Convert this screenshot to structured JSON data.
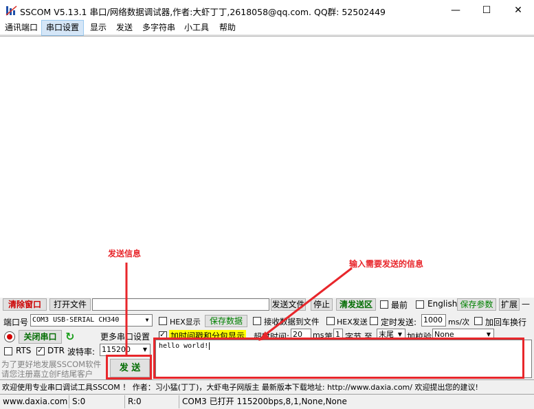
{
  "window": {
    "title": "SSCOM V5.13.1 串口/网络数据调试器,作者:大虾丁丁,2618058@qq.com. QQ群: 52502449",
    "minimize": "—",
    "maximize": "☐",
    "close": "✕"
  },
  "menu": [
    "通讯端口",
    "串口设置",
    "显示",
    "发送",
    "多字符串",
    "小工具",
    "帮助"
  ],
  "row1": {
    "clear": "清除窗口",
    "open_file": "打开文件",
    "send_file": "发送文件",
    "stop": "停止",
    "clear_send": "清发送区",
    "front": "最前",
    "english": "English",
    "save_params": "保存参数",
    "expand": "扩展",
    "dash": "—"
  },
  "row2": {
    "port_label": "端口号",
    "port_value": "COM3 USB-SERIAL CH340",
    "hex_display": "HEX显示",
    "save_data": "保存数据",
    "recv_to_file": "接收数据到文件",
    "hex_send": "HEX发送",
    "timed_send": "定时发送:",
    "interval": "1000",
    "interval_unit": "ms/次",
    "add_crlf": "加回车换行"
  },
  "row3": {
    "close_port": "关闭串口",
    "more_settings": "更多串口设置",
    "timestamp": "加时间戳和分包显示",
    "timeout_label": "超时时间:",
    "timeout_value": "20",
    "timeout_unit": "ms",
    "nth": "第",
    "byte_index": "1",
    "byte_to": "字节 至",
    "end": "末尾",
    "checksum": "加校验",
    "checksum_value": "None"
  },
  "row4": {
    "rts": "RTS",
    "dtr": "DTR",
    "baud_label": "波特率:",
    "baud_value": "115200"
  },
  "promo": {
    "line1": "为了更好地发展SSCOM软件",
    "line2": "请您注册嘉立创F结尾客户"
  },
  "send": {
    "button": "发 送",
    "text": "hello world!"
  },
  "annotations": {
    "send_info": "发送信息",
    "input_info": "输入需要发送的信息"
  },
  "infobar": {
    "text": "欢迎使用专业串口调试工具SSCOM ！  作者：习小猛(丁丁)，大虾电子网版主  最新版本下载地址: http://www.daxia.com/ 欢迎提出您的建议!"
  },
  "status": {
    "site": "www.daxia.com",
    "s": "S:0",
    "r": "R:0",
    "port_state": "COM3 已打开  115200bps,8,1,None,None"
  },
  "colors": {
    "annotation_red": "#e8262b",
    "green_text": "#008000",
    "highlight_yellow": "#ffff00"
  }
}
